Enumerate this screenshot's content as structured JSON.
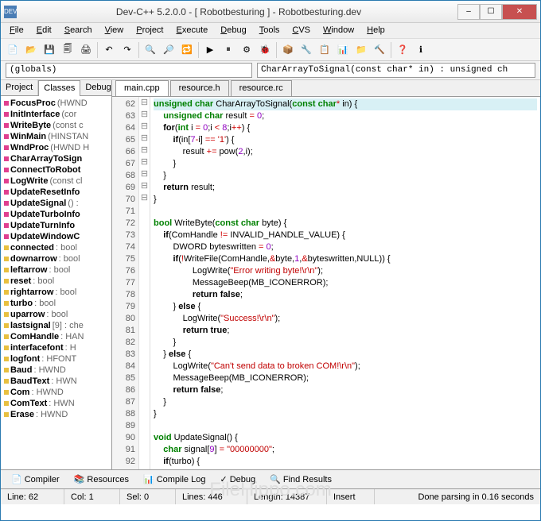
{
  "title": "Dev-C++ 5.2.0.0 - [ Robotbesturing ] - Robotbesturing.dev",
  "titlebar_icon": "DEV",
  "winbtns": {
    "min": "–",
    "max": "☐",
    "close": "✕"
  },
  "menu": [
    "File",
    "Edit",
    "Search",
    "View",
    "Project",
    "Execute",
    "Debug",
    "Tools",
    "CVS",
    "Window",
    "Help"
  ],
  "toolbar_icons": [
    "📄",
    "📂",
    "💾",
    "🗐",
    "🖨",
    "|",
    "↶",
    "↷",
    "|",
    "🔍",
    "🔎",
    "🔁",
    "|",
    "▶",
    "⏸",
    "⚙",
    "🐞",
    "|",
    "📦",
    "🔧",
    "📋",
    "📊",
    "📁",
    "🔨",
    "|",
    "❓",
    "ℹ"
  ],
  "combo_globals": "(globals)",
  "combo_func": "CharArrayToSignal(const char* in) : unsigned ch",
  "left_tabs": [
    "Project",
    "Classes",
    "Debug"
  ],
  "left_active": 1,
  "tree": [
    {
      "t": "m",
      "n": "FocusProc",
      "p": "(HWND"
    },
    {
      "t": "m",
      "n": "InitInterface",
      "p": "(cor"
    },
    {
      "t": "m",
      "n": "WriteByte",
      "p": "(const c"
    },
    {
      "t": "m",
      "n": "WinMain",
      "p": "(HINSTAN"
    },
    {
      "t": "m",
      "n": "WndProc",
      "p": "(HWND H"
    },
    {
      "t": "m",
      "n": "CharArrayToSign",
      "p": ""
    },
    {
      "t": "m",
      "n": "ConnectToRobot",
      "p": ""
    },
    {
      "t": "m",
      "n": "LogWrite",
      "p": "(const cl"
    },
    {
      "t": "m",
      "n": "UpdateResetInfo",
      "p": ""
    },
    {
      "t": "m",
      "n": "UpdateSignal",
      "p": "() :"
    },
    {
      "t": "m",
      "n": "UpdateTurboInfo",
      "p": ""
    },
    {
      "t": "m",
      "n": "UpdateTurnInfo",
      "p": ""
    },
    {
      "t": "m",
      "n": "UpdateWindowC",
      "p": ""
    },
    {
      "t": "v",
      "n": "connected",
      "p": ": bool"
    },
    {
      "t": "v",
      "n": "downarrow",
      "p": ": bool"
    },
    {
      "t": "v",
      "n": "leftarrow",
      "p": ": bool"
    },
    {
      "t": "v",
      "n": "reset",
      "p": ": bool"
    },
    {
      "t": "v",
      "n": "rightarrow",
      "p": ": bool"
    },
    {
      "t": "v",
      "n": "turbo",
      "p": ": bool"
    },
    {
      "t": "v",
      "n": "uparrow",
      "p": ": bool"
    },
    {
      "t": "v",
      "n": "lastsignal",
      "p": "[9] : che"
    },
    {
      "t": "v",
      "n": "ComHandle",
      "p": ": HAN"
    },
    {
      "t": "v",
      "n": "interfacefont",
      "p": ": H"
    },
    {
      "t": "v",
      "n": "logfont",
      "p": ": HFONT"
    },
    {
      "t": "v",
      "n": "Baud",
      "p": ": HWND"
    },
    {
      "t": "v",
      "n": "BaudText",
      "p": ": HWN"
    },
    {
      "t": "v",
      "n": "Com",
      "p": ": HWND"
    },
    {
      "t": "v",
      "n": "ComText",
      "p": ": HWN"
    },
    {
      "t": "v",
      "n": "Erase",
      "p": ": HWND"
    }
  ],
  "editor_tabs": [
    "main.cpp",
    "resource.h",
    "resource.rc"
  ],
  "editor_active": 0,
  "line_start": 62,
  "fold": [
    "⊟",
    "",
    "",
    "",
    "⊟",
    "",
    "",
    "",
    "",
    "",
    "⊟",
    "⊟",
    "",
    "⊟",
    "",
    "",
    "",
    "⊟",
    "",
    "",
    "",
    "⊟",
    "",
    "",
    "",
    "",
    "",
    "",
    "⊟",
    "",
    "⊟"
  ],
  "code": [
    {
      "hl": true,
      "h": "<span class='ty'>unsigned char</span> CharArrayToSignal(<span class='ty'>const char</span><span class='op'>*</span> in) {"
    },
    {
      "h": "    <span class='ty'>unsigned char</span> result <span class='op'>=</span> <span class='num'>0</span>;"
    },
    {
      "h": "    <span class='kw'>for</span>(<span class='ty'>int</span> i <span class='op'>=</span> <span class='num'>0</span>;i <span class='op'>&lt;</span> <span class='num'>8</span>;i<span class='op'>++</span>) {"
    },
    {
      "h": "        <span class='kw'>if</span>(in[<span class='num'>7</span><span class='op'>-</span>i] <span class='op'>==</span> <span class='str'>'1'</span>) {"
    },
    {
      "h": "            result <span class='op'>+=</span> pow(<span class='num'>2</span>,i);"
    },
    {
      "h": "        }"
    },
    {
      "h": "    }"
    },
    {
      "h": "    <span class='kw'>return</span> result;"
    },
    {
      "h": "}"
    },
    {
      "h": ""
    },
    {
      "h": "<span class='ty'>bool</span> WriteByte(<span class='ty'>const char</span> byte) {"
    },
    {
      "h": "    <span class='kw'>if</span>(ComHandle <span class='op'>!=</span> INVALID_HANDLE_VALUE) {"
    },
    {
      "h": "        DWORD byteswritten <span class='op'>=</span> <span class='num'>0</span>;"
    },
    {
      "h": "        <span class='kw'>if</span>(<span class='op'>!</span>WriteFile(ComHandle,<span class='op'>&amp;</span>byte,<span class='num'>1</span>,<span class='op'>&amp;</span>byteswritten,NULL)) {"
    },
    {
      "h": "                LogWrite(<span class='str'>\"Error writing byte!\\r\\n\"</span>);"
    },
    {
      "h": "                MessageBeep(MB_ICONERROR);"
    },
    {
      "h": "                <span class='kw'>return false</span>;"
    },
    {
      "h": "        } <span class='kw'>else</span> {"
    },
    {
      "h": "            LogWrite(<span class='str'>\"Success!\\r\\n\"</span>);"
    },
    {
      "h": "            <span class='kw'>return true</span>;"
    },
    {
      "h": "        }"
    },
    {
      "h": "    } <span class='kw'>else</span> {"
    },
    {
      "h": "        LogWrite(<span class='str'>\"Can't send data to broken COM!\\r\\n\"</span>);"
    },
    {
      "h": "        MessageBeep(MB_ICONERROR);"
    },
    {
      "h": "        <span class='kw'>return false</span>;"
    },
    {
      "h": "    }"
    },
    {
      "h": "}"
    },
    {
      "h": ""
    },
    {
      "h": "<span class='ty'>void</span> UpdateSignal() {"
    },
    {
      "h": "    <span class='ty'>char</span> signal[<span class='num'>9</span>] <span class='op'>=</span> <span class='str'>\"00000000\"</span>;"
    },
    {
      "h": "    <span class='kw'>if</span>(turbo) {"
    }
  ],
  "bottom_tabs": [
    {
      "icon": "📄",
      "label": "Compiler"
    },
    {
      "icon": "📚",
      "label": "Resources"
    },
    {
      "icon": "📊",
      "label": "Compile Log"
    },
    {
      "icon": "✓",
      "label": "Debug"
    },
    {
      "icon": "🔍",
      "label": "Find Results"
    }
  ],
  "status": {
    "line": "Line:   62",
    "col": "Col:   1",
    "sel": "Sel:   0",
    "lines": "Lines:  446",
    "length": "Length:  14387",
    "insert": "Insert",
    "msg": "Done parsing in 0.16 seconds"
  },
  "watermark": "FileHippo.com"
}
